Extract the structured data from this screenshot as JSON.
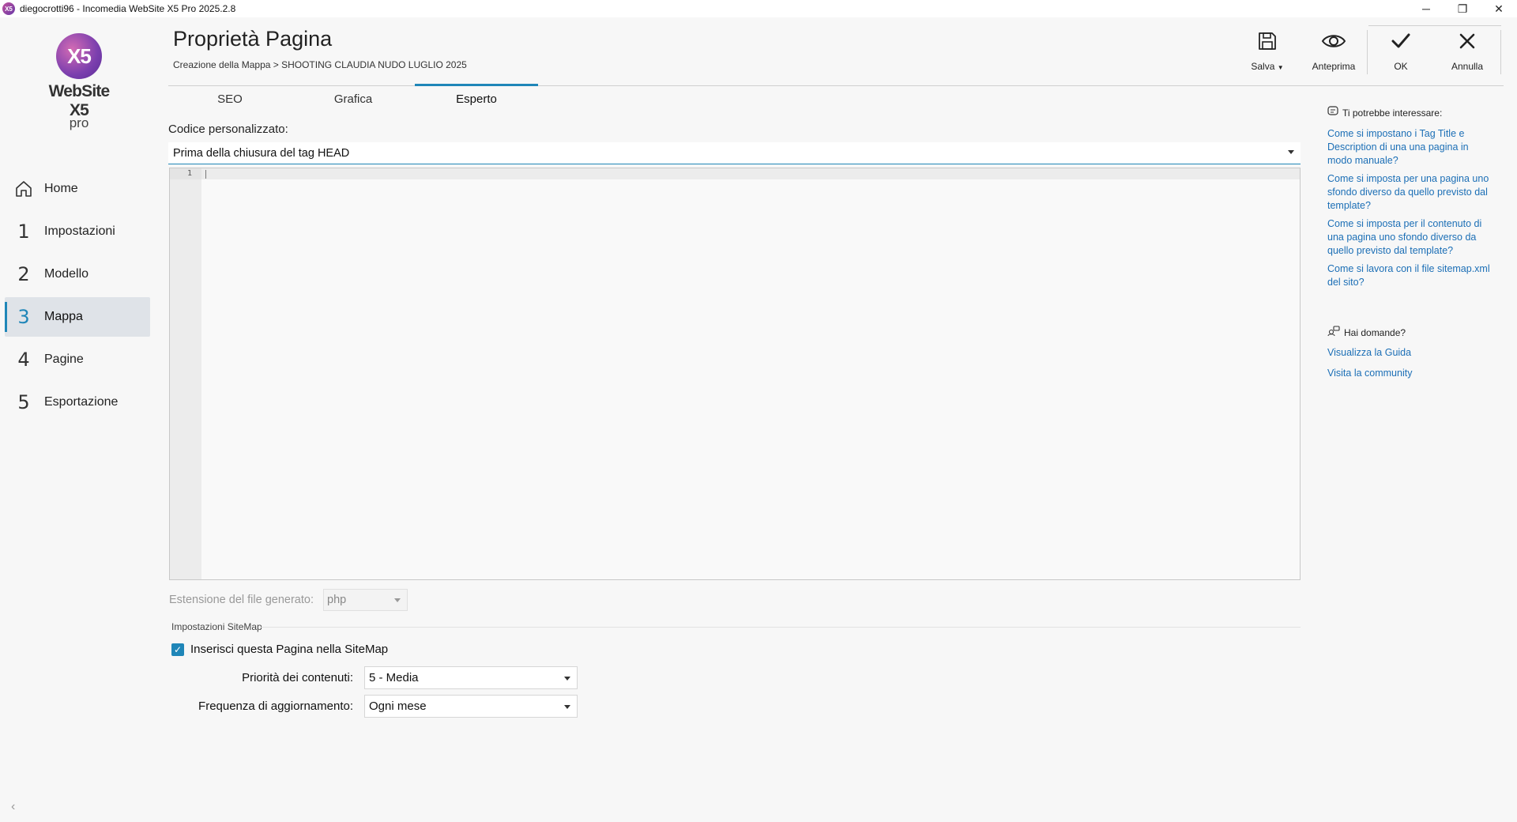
{
  "window": {
    "title": "diegocrotti96 - Incomedia WebSite X5 Pro 2025.2.8",
    "app_icon": "X5",
    "controls": {
      "minimize": "─",
      "restore": "❐",
      "close": "✕"
    }
  },
  "logo": {
    "mark": "X5",
    "name": "WebSite X5",
    "edition": "pro"
  },
  "sidebar": {
    "items": [
      {
        "num": "",
        "label": "Home",
        "icon": "home-icon"
      },
      {
        "num": "1",
        "label": "Impostazioni"
      },
      {
        "num": "2",
        "label": "Modello"
      },
      {
        "num": "3",
        "label": "Mappa",
        "active": true
      },
      {
        "num": "4",
        "label": "Pagine"
      },
      {
        "num": "5",
        "label": "Esportazione"
      }
    ],
    "collapse": "‹"
  },
  "header": {
    "title": "Proprietà Pagina",
    "breadcrumb": "Creazione della Mappa > SHOOTING CLAUDIA NUDO LUGLIO 2025"
  },
  "toolbar": {
    "save": "Salva",
    "preview": "Anteprima",
    "ok": "OK",
    "cancel": "Annulla"
  },
  "tabs": [
    "SEO",
    "Grafica",
    "Esperto"
  ],
  "active_tab": "Esperto",
  "main": {
    "code_label": "Codice personalizzato:",
    "code_position": "Prima della chiusura del tag HEAD",
    "editor_line": "1",
    "ext_label": "Estensione del file generato:",
    "ext_value": "php",
    "sitemap_title": "Impostazioni SiteMap",
    "sitemap_checkbox": "Inserisci questa Pagina nella SiteMap",
    "sitemap_checked": true,
    "priority_label": "Priorità dei contenuti:",
    "priority_value": "5 - Media",
    "frequency_label": "Frequenza di aggiornamento:",
    "frequency_value": "Ogni mese"
  },
  "help": {
    "title": "Ti potrebbe interessare:",
    "links": [
      "Come si impostano i Tag Title e Description di una una pagina in modo manuale?",
      "Come si imposta per una pagina uno sfondo diverso da quello previsto dal template?",
      "Come si imposta per il contenuto di una pagina uno sfondo diverso da quello previsto dal template?",
      "Come si lavora con il file sitemap.xml del sito?"
    ],
    "questions_title": "Hai domande?",
    "guide": "Visualizza la Guida",
    "community": "Visita la community"
  },
  "colors": {
    "accent": "#1f86b8",
    "link": "#1c6fb6",
    "logo": "#7b3fae"
  }
}
